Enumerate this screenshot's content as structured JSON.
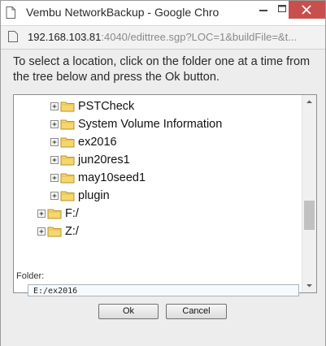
{
  "window": {
    "title": "Vembu NetworkBackup - Google Chro",
    "controls": {
      "minimize_icon": "minimize-icon",
      "maximize_icon": "maximize-icon",
      "close_icon": "close-icon"
    }
  },
  "address_bar": {
    "host": "192.168.103.81",
    "rest": ":4040/edittree.sgp?LOC=1&buildFile=&t..."
  },
  "dialog": {
    "instructions": "To select a location, click on the folder one at a time from the tree below and press the Ok button.",
    "tree": [
      {
        "label": "PSTCheck",
        "level": 2,
        "toggle": "plus"
      },
      {
        "label": "System Volume Information",
        "level": 2,
        "toggle": "plus"
      },
      {
        "label": "ex2016",
        "level": 2,
        "toggle": "plus"
      },
      {
        "label": "jun20res1",
        "level": 2,
        "toggle": "plus"
      },
      {
        "label": "may10seed1",
        "level": 2,
        "toggle": "plus"
      },
      {
        "label": "plugin",
        "level": 2,
        "toggle": "plus"
      },
      {
        "label": "F:/",
        "level": 1,
        "toggle": "plus"
      },
      {
        "label": "Z:/",
        "level": 1,
        "toggle": "plus"
      }
    ],
    "folder_label": "Folder:",
    "folder_value": "E:/ex2016",
    "ok_label": "Ok",
    "cancel_label": "Cancel"
  },
  "colors": {
    "close_button": "#c7504d",
    "folder_fill": "#f5d76e",
    "dialog_bg": "#ededed"
  }
}
